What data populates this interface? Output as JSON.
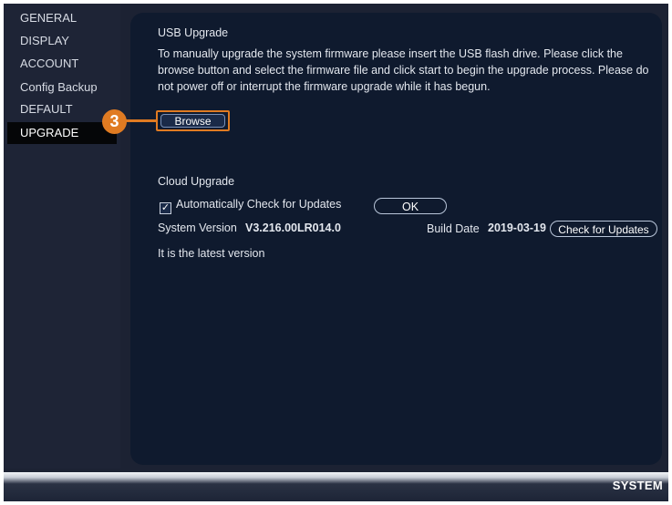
{
  "sidebar": {
    "items": [
      {
        "label": "GENERAL",
        "active": false
      },
      {
        "label": "DISPLAY",
        "active": false
      },
      {
        "label": "ACCOUNT",
        "active": false
      },
      {
        "label": "Config Backup",
        "active": false
      },
      {
        "label": "DEFAULT",
        "active": false
      },
      {
        "label": "UPGRADE",
        "active": true
      }
    ]
  },
  "usb_upgrade": {
    "title": "USB Upgrade",
    "description": "To manually upgrade the system firmware please insert the USB flash drive. Please click the browse button and select the firmware file and click start to begin the upgrade process. Please do not power off or interrupt the firmware upgrade while it has begun.",
    "browse_label": "Browse",
    "callout_number": "3"
  },
  "cloud_upgrade": {
    "title": "Cloud Upgrade",
    "auto_check_label": "Automatically Check for Updates",
    "auto_check_checked": true,
    "ok_label": "OK",
    "system_version_label": "System Version",
    "system_version_value": "V3.216.00LR014.0",
    "build_date_label": "Build Date",
    "build_date_value": "2019-03-19",
    "check_updates_label": "Check for Updates",
    "status_text": "It is the latest version"
  },
  "footer": {
    "section_label": "SYSTEM"
  },
  "colors": {
    "accent": "#e07b22",
    "panel": "#0f1a2e",
    "background": "#1c2233"
  }
}
